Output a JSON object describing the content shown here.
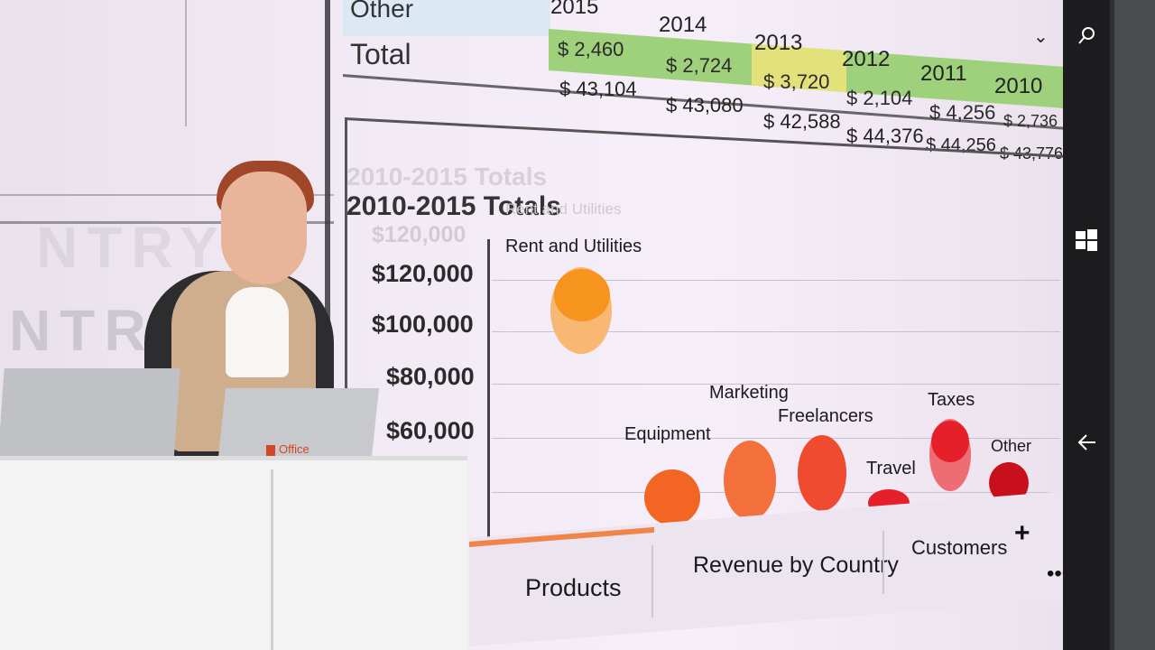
{
  "sheet": {
    "row_labels": {
      "other": "Other",
      "total": "Total"
    },
    "years": [
      "2015",
      "2014",
      "2013",
      "2012",
      "2011",
      "2010"
    ],
    "other_row": [
      "$ 2,460",
      "$ 2,724",
      "$ 3,720",
      "$ 2,104",
      "$ 4,256",
      "$ 2,736"
    ],
    "total_row": [
      "$ 43,104",
      "$ 43,080",
      "$ 42,588",
      "$ 44,376",
      "$ 44,256",
      "$ 43,776"
    ]
  },
  "chart": {
    "title": "2010-2015 Totals",
    "y_ticks": [
      "$120,000",
      "$100,000",
      "$80,000",
      "$60,000"
    ],
    "categories": [
      "Rent and Utilities",
      "Equipment",
      "Marketing",
      "Freelancers",
      "Travel",
      "Taxes",
      "Other"
    ],
    "colors": {
      "orange": "#f7941d",
      "orange_red": "#f26522",
      "red": "#e5202a",
      "deep_red": "#c8101c",
      "pink": "#f5a3a6"
    }
  },
  "tabs": [
    "Products",
    "Revenue by Country",
    "Customers"
  ],
  "add_tab_label": "+",
  "more_label": "•••",
  "dropdown_icon": "chevron-down-icon",
  "phone_bar": {
    "icons": [
      "search-icon",
      "windows-icon",
      "back-arrow-icon"
    ]
  },
  "podium_brand": "Office"
}
